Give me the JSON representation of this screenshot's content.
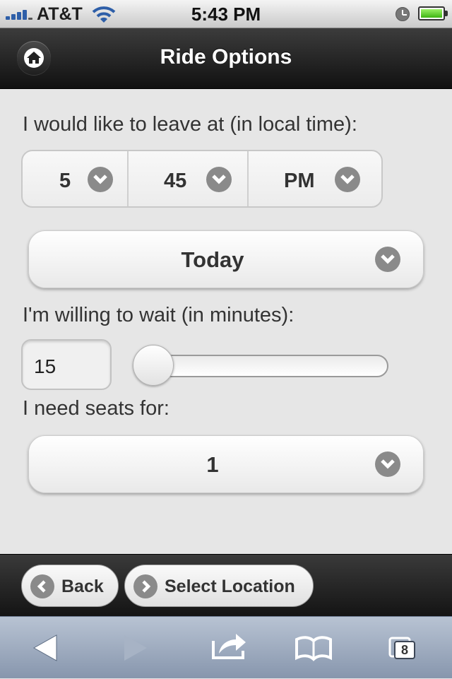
{
  "status_bar": {
    "carrier": "AT&T",
    "time": "5:43 PM"
  },
  "header": {
    "title": "Ride Options",
    "home_icon": "home-icon"
  },
  "form": {
    "leave_label": "I would like to leave at (in local time):",
    "hour": "5",
    "minute": "45",
    "ampm": "PM",
    "day": "Today",
    "wait_label": "I'm willing to wait (in minutes):",
    "wait_minutes": "15",
    "wait_slider_fraction": 0.0,
    "seats_label": "I need seats for:",
    "seats": "1"
  },
  "footer": {
    "back_label": "Back",
    "select_location_label": "Select Location"
  },
  "browser_toolbar": {
    "tabs_count": "8"
  },
  "colors": {
    "header_bg": "#1c1c1c",
    "content_bg": "#e6e6e6",
    "chevron_bg": "#8a8a8a",
    "toolbar_bg": "#9aa7bb"
  }
}
